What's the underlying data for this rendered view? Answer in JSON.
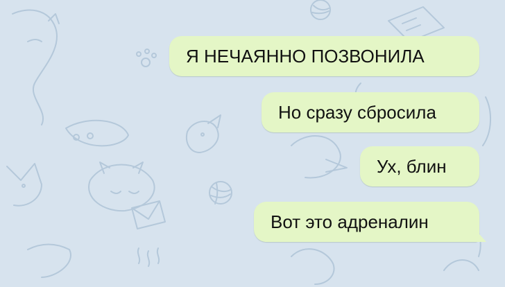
{
  "chat": {
    "background_color": "#d7e3ee",
    "bubble_color": "#e4f6c6",
    "messages": [
      {
        "text": "Я НЕЧАЯННО ПОЗВОНИЛА"
      },
      {
        "text": "Но сразу сбросила"
      },
      {
        "text": "Ух, блин"
      },
      {
        "text": "Вот это адреналин"
      }
    ]
  }
}
